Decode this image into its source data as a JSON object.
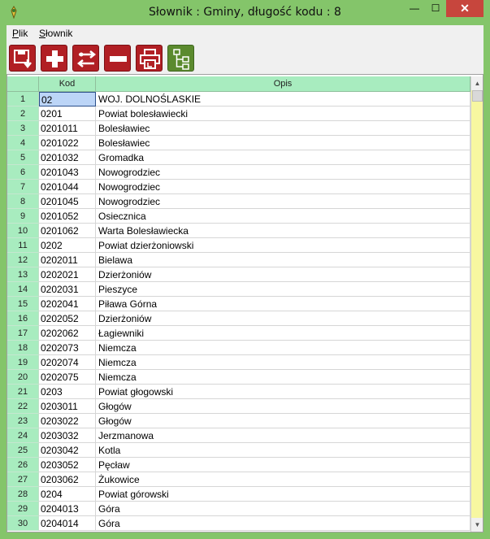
{
  "window": {
    "title": "Słownik : Gminy,  długość kodu : 8",
    "controls": {
      "minimize": "—",
      "maximize": "☐",
      "close": "✕"
    }
  },
  "menu": [
    {
      "label": "Plik"
    },
    {
      "label": "Słownik"
    }
  ],
  "toolbar": {
    "buttons": [
      {
        "name": "save",
        "icon": "save-icon"
      },
      {
        "name": "add",
        "icon": "plus-icon"
      },
      {
        "name": "swap",
        "icon": "swap-arrows-icon"
      },
      {
        "name": "delete",
        "icon": "minus-icon"
      },
      {
        "name": "print",
        "icon": "printer-icon"
      },
      {
        "name": "tree",
        "icon": "tree-icon"
      }
    ]
  },
  "colors": {
    "frame": "#84c56a",
    "header": "#a8ecbf",
    "toolbar_red": "#b11f24",
    "toolbar_green": "#5b8a2e",
    "scroll_track": "#f7f7a0",
    "selection": "#bcd5f7"
  },
  "grid": {
    "columns": {
      "num": "",
      "kod": "Kod",
      "opis": "Opis"
    },
    "rows": [
      {
        "num": "1",
        "kod": "02",
        "opis": "WOJ. DOLNOŚLASKIE"
      },
      {
        "num": "2",
        "kod": "0201",
        "opis": "Powiat bolesławiecki"
      },
      {
        "num": "3",
        "kod": "0201011",
        "opis": "Bolesławiec"
      },
      {
        "num": "4",
        "kod": "0201022",
        "opis": "Bolesławiec"
      },
      {
        "num": "5",
        "kod": "0201032",
        "opis": "Gromadka"
      },
      {
        "num": "6",
        "kod": "0201043",
        "opis": "Nowogrodziec"
      },
      {
        "num": "7",
        "kod": "0201044",
        "opis": "Nowogrodziec"
      },
      {
        "num": "8",
        "kod": "0201045",
        "opis": "Nowogrodziec"
      },
      {
        "num": "9",
        "kod": "0201052",
        "opis": "Osiecznica"
      },
      {
        "num": "10",
        "kod": "0201062",
        "opis": "Warta Bolesławiecka"
      },
      {
        "num": "11",
        "kod": "0202",
        "opis": "Powiat dzierżoniowski"
      },
      {
        "num": "12",
        "kod": "0202011",
        "opis": "Bielawa"
      },
      {
        "num": "13",
        "kod": "0202021",
        "opis": "Dzierżoniów"
      },
      {
        "num": "14",
        "kod": "0202031",
        "opis": "Pieszyce"
      },
      {
        "num": "15",
        "kod": "0202041",
        "opis": "Piława Górna"
      },
      {
        "num": "16",
        "kod": "0202052",
        "opis": "Dzierżoniów"
      },
      {
        "num": "17",
        "kod": "0202062",
        "opis": "Łagiewniki"
      },
      {
        "num": "18",
        "kod": "0202073",
        "opis": "Niemcza"
      },
      {
        "num": "19",
        "kod": "0202074",
        "opis": "Niemcza"
      },
      {
        "num": "20",
        "kod": "0202075",
        "opis": "Niemcza"
      },
      {
        "num": "21",
        "kod": "0203",
        "opis": "Powiat głogowski"
      },
      {
        "num": "22",
        "kod": "0203011",
        "opis": "Głogów"
      },
      {
        "num": "23",
        "kod": "0203022",
        "opis": "Głogów"
      },
      {
        "num": "24",
        "kod": "0203032",
        "opis": "Jerzmanowa"
      },
      {
        "num": "25",
        "kod": "0203042",
        "opis": "Kotla"
      },
      {
        "num": "26",
        "kod": "0203052",
        "opis": "Pęcław"
      },
      {
        "num": "27",
        "kod": "0203062",
        "opis": "Żukowice"
      },
      {
        "num": "28",
        "kod": "0204",
        "opis": "Powiat górowski"
      },
      {
        "num": "29",
        "kod": "0204013",
        "opis": "Góra"
      },
      {
        "num": "30",
        "kod": "0204014",
        "opis": "Góra"
      }
    ]
  }
}
